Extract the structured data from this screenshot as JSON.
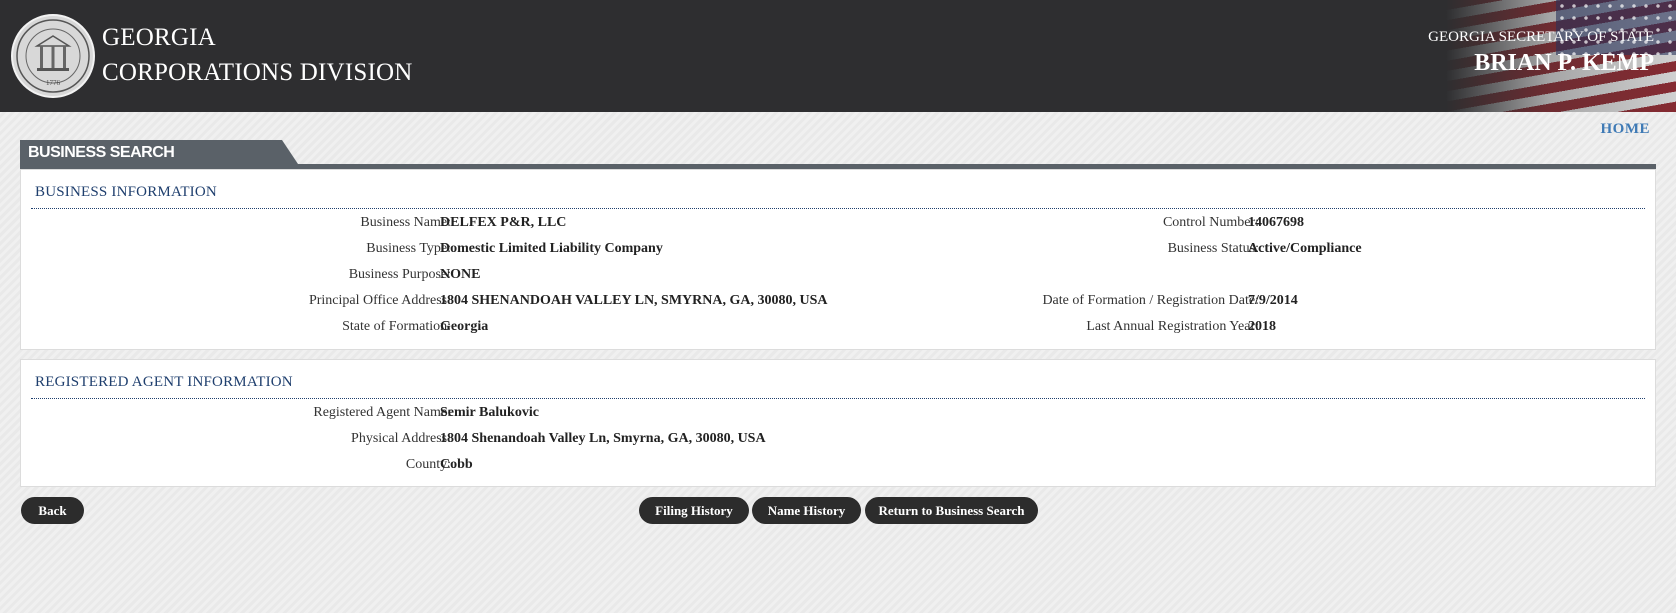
{
  "header": {
    "title_line1": "GEORGIA",
    "title_line2": "CORPORATIONS DIVISION",
    "secretary_label": "GEORGIA SECRETARY OF STATE",
    "secretary_name": "BRIAN P. KEMP",
    "seal_year": "1776"
  },
  "nav": {
    "home": "HOME"
  },
  "tab": {
    "label": "BUSINESS SEARCH"
  },
  "business_info": {
    "title": "BUSINESS INFORMATION",
    "left": [
      {
        "label": "Business Name:",
        "value": "DELFEX P&R, LLC"
      },
      {
        "label": "Business Type:",
        "value": "Domestic Limited Liability Company"
      },
      {
        "label": "Business Purpose:",
        "value": "NONE"
      },
      {
        "label": "Principal Office Address:",
        "value": "1804 SHENANDOAH VALLEY LN, SMYRNA, GA, 30080, USA"
      },
      {
        "label": "State of Formation:",
        "value": "Georgia"
      }
    ],
    "right": [
      {
        "label": "Control Number:",
        "value": "14067698"
      },
      {
        "label": "Business Status:",
        "value": "Active/Compliance"
      },
      {
        "label": "Date of Formation / Registration Date:",
        "value": "7/9/2014"
      },
      {
        "label": "Last Annual Registration Year:",
        "value": "2018"
      }
    ]
  },
  "agent_info": {
    "title": "REGISTERED AGENT INFORMATION",
    "rows": [
      {
        "label": "Registered Agent Name:",
        "value": "Semir Balukovic"
      },
      {
        "label": "Physical Address:",
        "value": "1804 Shenandoah Valley Ln, Smyrna, GA, 30080, USA"
      },
      {
        "label": "County:",
        "value": "Cobb"
      }
    ]
  },
  "buttons": {
    "back": "Back",
    "filing_history": "Filing History",
    "name_history": "Name History",
    "return_search": "Return to Business Search"
  }
}
